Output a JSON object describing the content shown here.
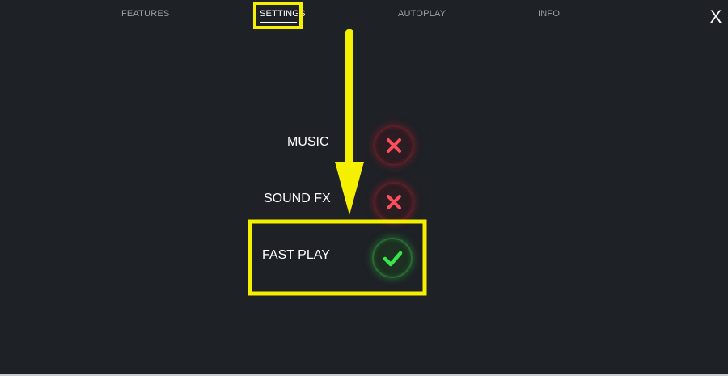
{
  "tabs": [
    {
      "label": "FEATURES",
      "active": false
    },
    {
      "label": "SETTINGS",
      "active": true
    },
    {
      "label": "AUTOPLAY",
      "active": false
    },
    {
      "label": "INFO",
      "active": false
    }
  ],
  "close_label": "X",
  "settings": [
    {
      "label": "MUSIC",
      "state": "off",
      "icon": "cross-icon"
    },
    {
      "label": "SOUND FX",
      "state": "off",
      "icon": "cross-icon"
    },
    {
      "label": "FAST PLAY",
      "state": "on",
      "icon": "check-icon"
    }
  ],
  "colors": {
    "background": "#1e2126",
    "annotation": "#f5f000",
    "off_icon": "#ff4d5a",
    "on_icon": "#37e64a"
  }
}
